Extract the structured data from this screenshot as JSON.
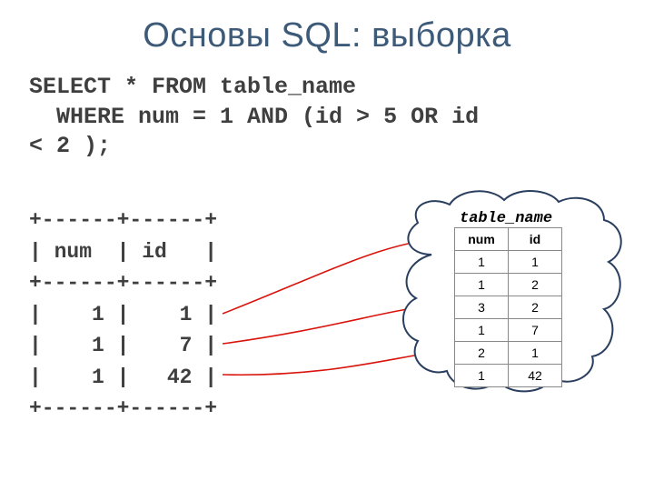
{
  "title": "Основы SQL: выборка",
  "sql": {
    "line1": "SELECT * FROM table_name",
    "line2": "  WHERE num = 1 AND (id > 5 OR id",
    "line3": "< 2 );"
  },
  "result": {
    "border": "+------+------+",
    "header": "| num  | id   |",
    "rows": [
      "|    1 |    1 |",
      "|    1 |    7 |",
      "|    1 |   42 |"
    ]
  },
  "source_table": {
    "label": "table_name",
    "headers": [
      "num",
      "id"
    ],
    "rows": [
      [
        "1",
        "1"
      ],
      [
        "1",
        "2"
      ],
      [
        "3",
        "2"
      ],
      [
        "1",
        "7"
      ],
      [
        "2",
        "1"
      ],
      [
        "1",
        "42"
      ]
    ]
  },
  "chart_data": {
    "type": "table",
    "title": "SQL SELECT with WHERE filter",
    "query": "SELECT * FROM table_name WHERE num = 1 AND (id > 5 OR id < 2);",
    "source_table": {
      "columns": [
        "num",
        "id"
      ],
      "rows": [
        [
          1,
          1
        ],
        [
          1,
          2
        ],
        [
          3,
          2
        ],
        [
          1,
          7
        ],
        [
          2,
          1
        ],
        [
          1,
          42
        ]
      ]
    },
    "result_table": {
      "columns": [
        "num",
        "id"
      ],
      "rows": [
        [
          1,
          1
        ],
        [
          1,
          7
        ],
        [
          1,
          42
        ]
      ]
    },
    "mapping": [
      {
        "result_row_index": 0,
        "source_row_index": 0
      },
      {
        "result_row_index": 1,
        "source_row_index": 3
      },
      {
        "result_row_index": 2,
        "source_row_index": 5
      }
    ]
  }
}
